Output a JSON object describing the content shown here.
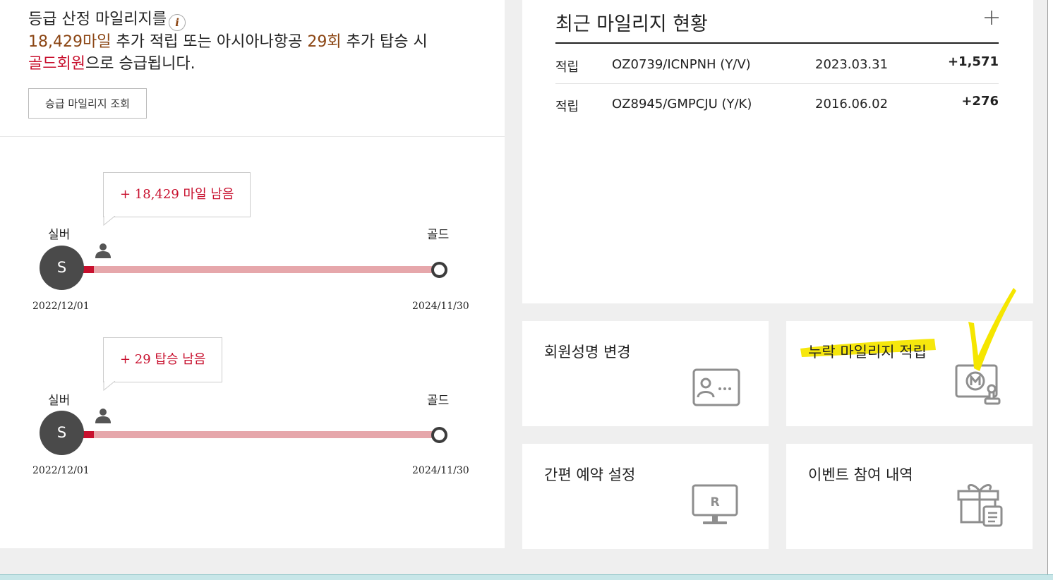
{
  "grade": {
    "intro": "등급 산정 마일리지를",
    "info_icon": "i",
    "miles": "18,429마일",
    "plus_text": "추가 적립 또는 아시아나항공",
    "flights": "29회",
    "flights_text": "추가 탑승 시",
    "target_grade": "골드회원",
    "promo_text": "으로 승급됩니다.",
    "lookup_button": "승급 마일리지 조회"
  },
  "progress": [
    {
      "bubble": "+ 18,429 마일 남음",
      "from_grade": "실버",
      "to_grade": "골드",
      "badge": "S",
      "start_date": "2022/12/01",
      "end_date": "2024/11/30",
      "filled_fraction": 0.03
    },
    {
      "bubble": "+ 29 탑승 남음",
      "from_grade": "실버",
      "to_grade": "골드",
      "badge": "S",
      "start_date": "2022/12/01",
      "end_date": "2024/11/30",
      "filled_fraction": 0.03
    }
  ],
  "recent": {
    "title": "최근 마일리지 현황",
    "more_icon": "plus-icon",
    "rows": [
      {
        "type": "적립",
        "flight": "OZ0739/ICNPNH (Y/V)",
        "date": "2023.03.31",
        "amount": "+1,571"
      },
      {
        "type": "적립",
        "flight": "OZ8945/GMPCJU (Y/K)",
        "date": "2016.06.02",
        "amount": "+276"
      }
    ]
  },
  "tiles": [
    {
      "label": "회원성명 변경",
      "icon": "member-card-icon"
    },
    {
      "label": "누락 마일리지 적립",
      "icon": "mileage-stamp-icon"
    },
    {
      "label": "간편 예약 설정",
      "icon": "monitor-r-icon"
    },
    {
      "label": "이벤트 참여 내역",
      "icon": "gift-icon"
    }
  ],
  "colors": {
    "accent_red": "#c8102e",
    "brown": "#8b4513",
    "bar_track": "#e6a7ab",
    "highlight": "#f5e600"
  }
}
